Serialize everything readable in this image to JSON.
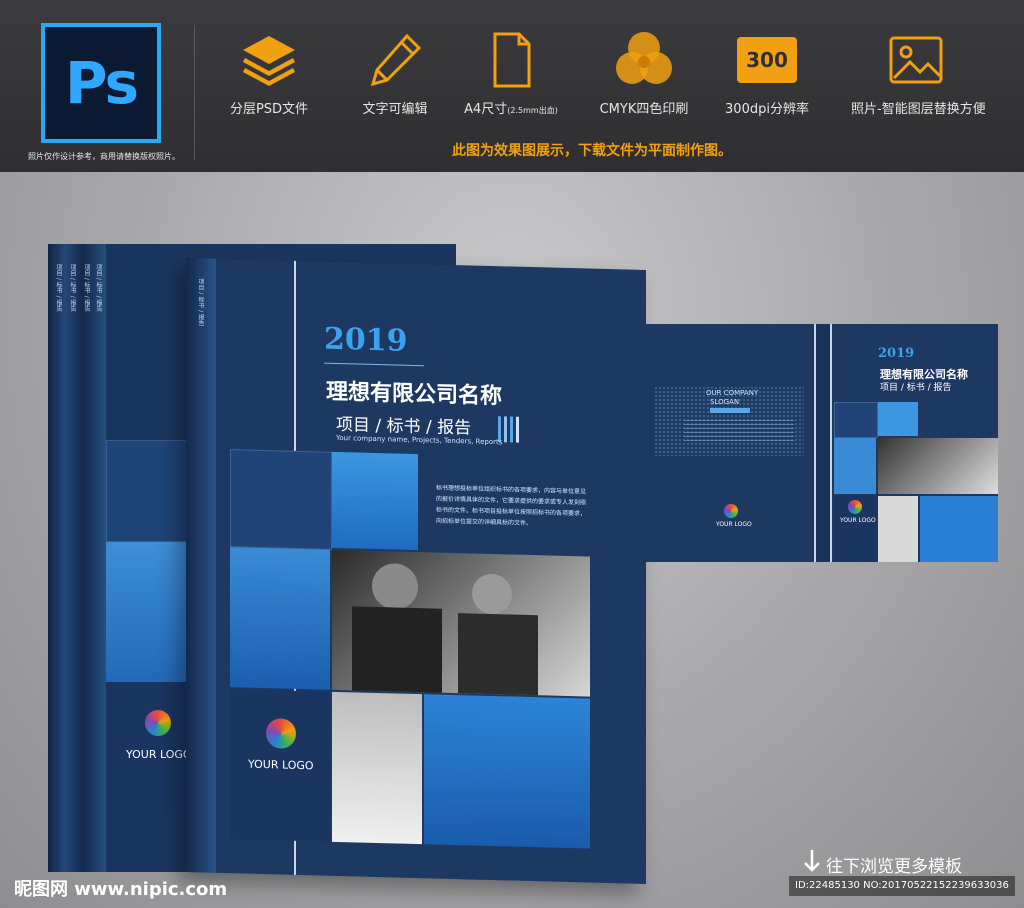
{
  "header": {
    "logo_text": "Ps",
    "logo_note": "照片仅作设计参考，商用请替换版权照片。",
    "features": [
      {
        "icon": "layers-icon",
        "label": "分层PSD文件"
      },
      {
        "icon": "pencil-icon",
        "label": "文字可编辑"
      },
      {
        "icon": "document-icon",
        "label": "A4尺寸",
        "note": "(2.5mm出血)"
      },
      {
        "icon": "cmyk-icon",
        "label": "CMYK四色印刷"
      },
      {
        "icon": "dpi-badge-icon",
        "badge": "300",
        "label": "300dpi分辨率"
      },
      {
        "icon": "image-icon",
        "label": "照片-智能图层替换方便"
      }
    ],
    "notice": "此图为效果图展示，下载文件为平面制作图。"
  },
  "cover": {
    "year": "2019",
    "company_name": "理想有限公司名称",
    "subtitle": "项目 / 标书 / 报告",
    "english": "Your company name, Projects, Tenders, Reports",
    "body_text": "标书理想投标单位组织标书的各项要求，内容与单位意见的报价详情具体的文件，它要求提供的要求或专人发到照标书的文件。标书项目投标单位按照招标书的各项要求，向招标单位提交的详细具标的文件。",
    "logo_text": "YOUR LOGO"
  },
  "flat": {
    "year": "2019",
    "company_name": "理想有限公司名称",
    "subtitle": "项目 / 标书 / 报告",
    "slogan_line1": "OUR COMPANY",
    "slogan_line2": "SLOGAN",
    "logo_text": "YOUR LOGO"
  },
  "footer": {
    "watermark": "昵图网 www.nipic.com",
    "browse_more": "往下浏览更多模板",
    "id_text": "ID:22485130 NO:20170522152239633036"
  },
  "colors": {
    "navy": "#1e3a64",
    "blue": "#2a7fd4",
    "light_blue": "#5aa6e6",
    "orange": "#f0a011"
  }
}
